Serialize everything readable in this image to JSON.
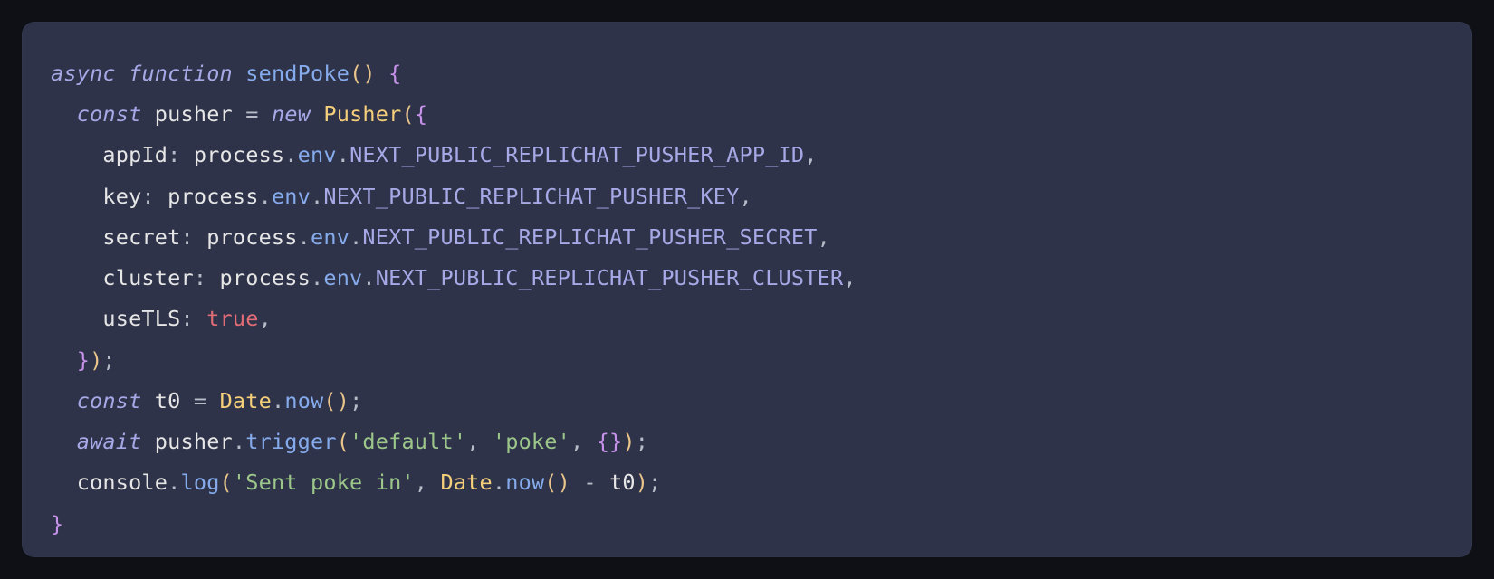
{
  "code": {
    "tokens": [
      [
        {
          "t": "async",
          "c": "keyword"
        },
        {
          "t": " ",
          "c": "punct"
        },
        {
          "t": "function",
          "c": "keyword"
        },
        {
          "t": " ",
          "c": "punct"
        },
        {
          "t": "sendPoke",
          "c": "fn-name"
        },
        {
          "t": "(",
          "c": "paren"
        },
        {
          "t": ")",
          "c": "paren"
        },
        {
          "t": " ",
          "c": "punct"
        },
        {
          "t": "{",
          "c": "brace"
        }
      ],
      [
        {
          "t": "  ",
          "c": "punct"
        },
        {
          "t": "const",
          "c": "keyword"
        },
        {
          "t": " pusher ",
          "c": "prop"
        },
        {
          "t": "=",
          "c": "punct"
        },
        {
          "t": " ",
          "c": "punct"
        },
        {
          "t": "new",
          "c": "keyword"
        },
        {
          "t": " ",
          "c": "punct"
        },
        {
          "t": "Pusher",
          "c": "class-name"
        },
        {
          "t": "(",
          "c": "paren"
        },
        {
          "t": "{",
          "c": "brace"
        }
      ],
      [
        {
          "t": "    appId",
          "c": "prop"
        },
        {
          "t": ":",
          "c": "punct"
        },
        {
          "t": " process",
          "c": "prop"
        },
        {
          "t": ".",
          "c": "dot"
        },
        {
          "t": "env",
          "c": "member"
        },
        {
          "t": ".",
          "c": "dot"
        },
        {
          "t": "NEXT_PUBLIC_REPLICHAT_PUSHER_APP_ID",
          "c": "env-const"
        },
        {
          "t": ",",
          "c": "punct"
        }
      ],
      [
        {
          "t": "    key",
          "c": "prop"
        },
        {
          "t": ":",
          "c": "punct"
        },
        {
          "t": " process",
          "c": "prop"
        },
        {
          "t": ".",
          "c": "dot"
        },
        {
          "t": "env",
          "c": "member"
        },
        {
          "t": ".",
          "c": "dot"
        },
        {
          "t": "NEXT_PUBLIC_REPLICHAT_PUSHER_KEY",
          "c": "env-const"
        },
        {
          "t": ",",
          "c": "punct"
        }
      ],
      [
        {
          "t": "    secret",
          "c": "prop"
        },
        {
          "t": ":",
          "c": "punct"
        },
        {
          "t": " process",
          "c": "prop"
        },
        {
          "t": ".",
          "c": "dot"
        },
        {
          "t": "env",
          "c": "member"
        },
        {
          "t": ".",
          "c": "dot"
        },
        {
          "t": "NEXT_PUBLIC_REPLICHAT_PUSHER_SECRET",
          "c": "env-const"
        },
        {
          "t": ",",
          "c": "punct"
        }
      ],
      [
        {
          "t": "    cluster",
          "c": "prop"
        },
        {
          "t": ":",
          "c": "punct"
        },
        {
          "t": " process",
          "c": "prop"
        },
        {
          "t": ".",
          "c": "dot"
        },
        {
          "t": "env",
          "c": "member"
        },
        {
          "t": ".",
          "c": "dot"
        },
        {
          "t": "NEXT_PUBLIC_REPLICHAT_PUSHER_CLUSTER",
          "c": "env-const"
        },
        {
          "t": ",",
          "c": "punct"
        }
      ],
      [
        {
          "t": "    useTLS",
          "c": "prop"
        },
        {
          "t": ":",
          "c": "punct"
        },
        {
          "t": " ",
          "c": "punct"
        },
        {
          "t": "true",
          "c": "bool"
        },
        {
          "t": ",",
          "c": "punct"
        }
      ],
      [
        {
          "t": "  ",
          "c": "punct"
        },
        {
          "t": "}",
          "c": "brace"
        },
        {
          "t": ")",
          "c": "paren"
        },
        {
          "t": ";",
          "c": "punct"
        }
      ],
      [
        {
          "t": "  ",
          "c": "punct"
        },
        {
          "t": "const",
          "c": "keyword"
        },
        {
          "t": " t0 ",
          "c": "prop"
        },
        {
          "t": "=",
          "c": "punct"
        },
        {
          "t": " ",
          "c": "punct"
        },
        {
          "t": "Date",
          "c": "class-name"
        },
        {
          "t": ".",
          "c": "dot"
        },
        {
          "t": "now",
          "c": "fn-name"
        },
        {
          "t": "(",
          "c": "paren"
        },
        {
          "t": ")",
          "c": "paren"
        },
        {
          "t": ";",
          "c": "punct"
        }
      ],
      [
        {
          "t": "  ",
          "c": "punct"
        },
        {
          "t": "await",
          "c": "keyword"
        },
        {
          "t": " pusher",
          "c": "prop"
        },
        {
          "t": ".",
          "c": "dot"
        },
        {
          "t": "trigger",
          "c": "fn-name"
        },
        {
          "t": "(",
          "c": "paren"
        },
        {
          "t": "'default'",
          "c": "string"
        },
        {
          "t": ", ",
          "c": "punct"
        },
        {
          "t": "'poke'",
          "c": "string"
        },
        {
          "t": ", ",
          "c": "punct"
        },
        {
          "t": "{",
          "c": "brace"
        },
        {
          "t": "}",
          "c": "brace"
        },
        {
          "t": ")",
          "c": "paren"
        },
        {
          "t": ";",
          "c": "punct"
        }
      ],
      [
        {
          "t": "  console",
          "c": "prop"
        },
        {
          "t": ".",
          "c": "dot"
        },
        {
          "t": "log",
          "c": "fn-name"
        },
        {
          "t": "(",
          "c": "paren"
        },
        {
          "t": "'Sent poke in'",
          "c": "string"
        },
        {
          "t": ", ",
          "c": "punct"
        },
        {
          "t": "Date",
          "c": "class-name"
        },
        {
          "t": ".",
          "c": "dot"
        },
        {
          "t": "now",
          "c": "fn-name"
        },
        {
          "t": "(",
          "c": "paren"
        },
        {
          "t": ")",
          "c": "paren"
        },
        {
          "t": " ",
          "c": "punct"
        },
        {
          "t": "-",
          "c": "punct"
        },
        {
          "t": " t0",
          "c": "prop"
        },
        {
          "t": ")",
          "c": "paren"
        },
        {
          "t": ";",
          "c": "punct"
        }
      ],
      [
        {
          "t": "}",
          "c": "brace"
        }
      ]
    ]
  }
}
